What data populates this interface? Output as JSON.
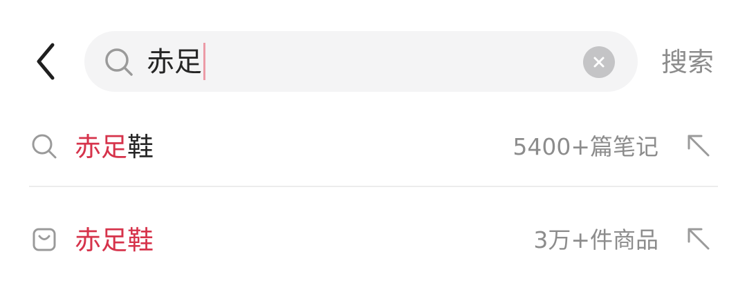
{
  "header": {
    "back_icon": "chevron-left-icon",
    "search": {
      "icon": "search-icon",
      "query": "赤足",
      "clear_icon": "clear-icon"
    },
    "search_button_label": "搜索"
  },
  "suggestions": [
    {
      "icon": "search-icon",
      "match_text": "赤足",
      "rest_text": "鞋",
      "meta": "5400+篇笔记",
      "fill_icon": "arrow-up-left-icon"
    },
    {
      "icon": "shopping-bag-icon",
      "match_text": "赤足鞋",
      "rest_text": "",
      "meta": "3万+件商品",
      "fill_icon": "arrow-up-left-icon"
    }
  ],
  "colors": {
    "highlight": "#d6334b",
    "secondary_text": "#8c8c8c",
    "primary_text": "#262626",
    "search_bg": "#f4f4f5",
    "caret": "#ec9aa6"
  }
}
